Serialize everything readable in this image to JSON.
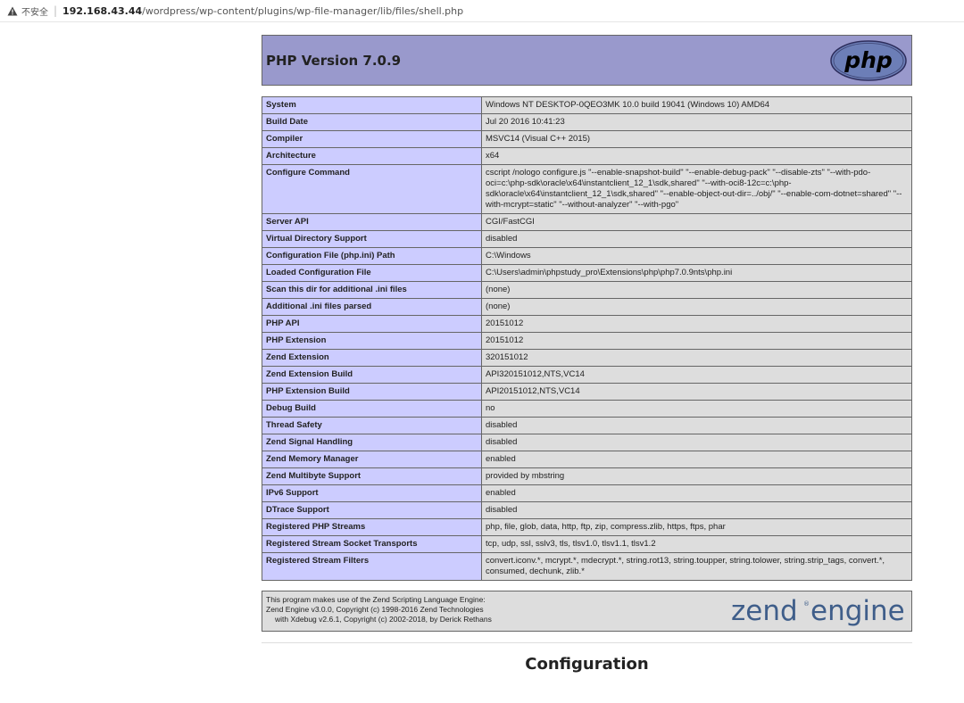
{
  "address_bar": {
    "insecure_label": "不安全",
    "host": "192.168.43.44",
    "path": "/wordpress/wp-content/plugins/wp-file-manager/lib/files/shell.php"
  },
  "header": {
    "title": "PHP Version 7.0.9",
    "logo_text": "php"
  },
  "info_rows": [
    {
      "key": "System",
      "value": "Windows NT DESKTOP-0QEO3MK 10.0 build 19041 (Windows 10) AMD64"
    },
    {
      "key": "Build Date",
      "value": "Jul 20 2016 10:41:23"
    },
    {
      "key": "Compiler",
      "value": "MSVC14 (Visual C++ 2015)"
    },
    {
      "key": "Architecture",
      "value": "x64"
    },
    {
      "key": "Configure Command",
      "value": "cscript /nologo configure.js \"--enable-snapshot-build\" \"--enable-debug-pack\" \"--disable-zts\" \"--with-pdo-oci=c:\\php-sdk\\oracle\\x64\\instantclient_12_1\\sdk,shared\" \"--with-oci8-12c=c:\\php-sdk\\oracle\\x64\\instantclient_12_1\\sdk,shared\" \"--enable-object-out-dir=../obj/\" \"--enable-com-dotnet=shared\" \"--with-mcrypt=static\" \"--without-analyzer\" \"--with-pgo\""
    },
    {
      "key": "Server API",
      "value": "CGI/FastCGI"
    },
    {
      "key": "Virtual Directory Support",
      "value": "disabled"
    },
    {
      "key": "Configuration File (php.ini) Path",
      "value": "C:\\Windows"
    },
    {
      "key": "Loaded Configuration File",
      "value": "C:\\Users\\admin\\phpstudy_pro\\Extensions\\php\\php7.0.9nts\\php.ini"
    },
    {
      "key": "Scan this dir for additional .ini files",
      "value": "(none)"
    },
    {
      "key": "Additional .ini files parsed",
      "value": "(none)"
    },
    {
      "key": "PHP API",
      "value": "20151012"
    },
    {
      "key": "PHP Extension",
      "value": "20151012"
    },
    {
      "key": "Zend Extension",
      "value": "320151012"
    },
    {
      "key": "Zend Extension Build",
      "value": "API320151012,NTS,VC14"
    },
    {
      "key": "PHP Extension Build",
      "value": "API20151012,NTS,VC14"
    },
    {
      "key": "Debug Build",
      "value": "no"
    },
    {
      "key": "Thread Safety",
      "value": "disabled"
    },
    {
      "key": "Zend Signal Handling",
      "value": "disabled"
    },
    {
      "key": "Zend Memory Manager",
      "value": "enabled"
    },
    {
      "key": "Zend Multibyte Support",
      "value": "provided by mbstring"
    },
    {
      "key": "IPv6 Support",
      "value": "enabled"
    },
    {
      "key": "DTrace Support",
      "value": "disabled"
    },
    {
      "key": "Registered PHP Streams",
      "value": "php, file, glob, data, http, ftp, zip, compress.zlib, https, ftps, phar"
    },
    {
      "key": "Registered Stream Socket Transports",
      "value": "tcp, udp, ssl, sslv3, tls, tlsv1.0, tlsv1.1, tlsv1.2"
    },
    {
      "key": "Registered Stream Filters",
      "value": "convert.iconv.*, mcrypt.*, mdecrypt.*, string.rot13, string.toupper, string.tolower, string.strip_tags, convert.*, consumed, dechunk, zlib.*"
    }
  ],
  "zend": {
    "line1": "This program makes use of the Zend Scripting Language Engine:",
    "line2": "Zend Engine v3.0.0, Copyright (c) 1998-2016 Zend Technologies",
    "line3": "with Xdebug v2.6.1, Copyright (c) 2002-2018, by Derick Rethans",
    "logo_text": "zend engine"
  },
  "section_title": "Configuration",
  "colors": {
    "header_bg": "#9999cc",
    "key_bg": "#ccccff",
    "value_bg": "#dddddd",
    "php_logo_bg": "#6c7eb7"
  }
}
